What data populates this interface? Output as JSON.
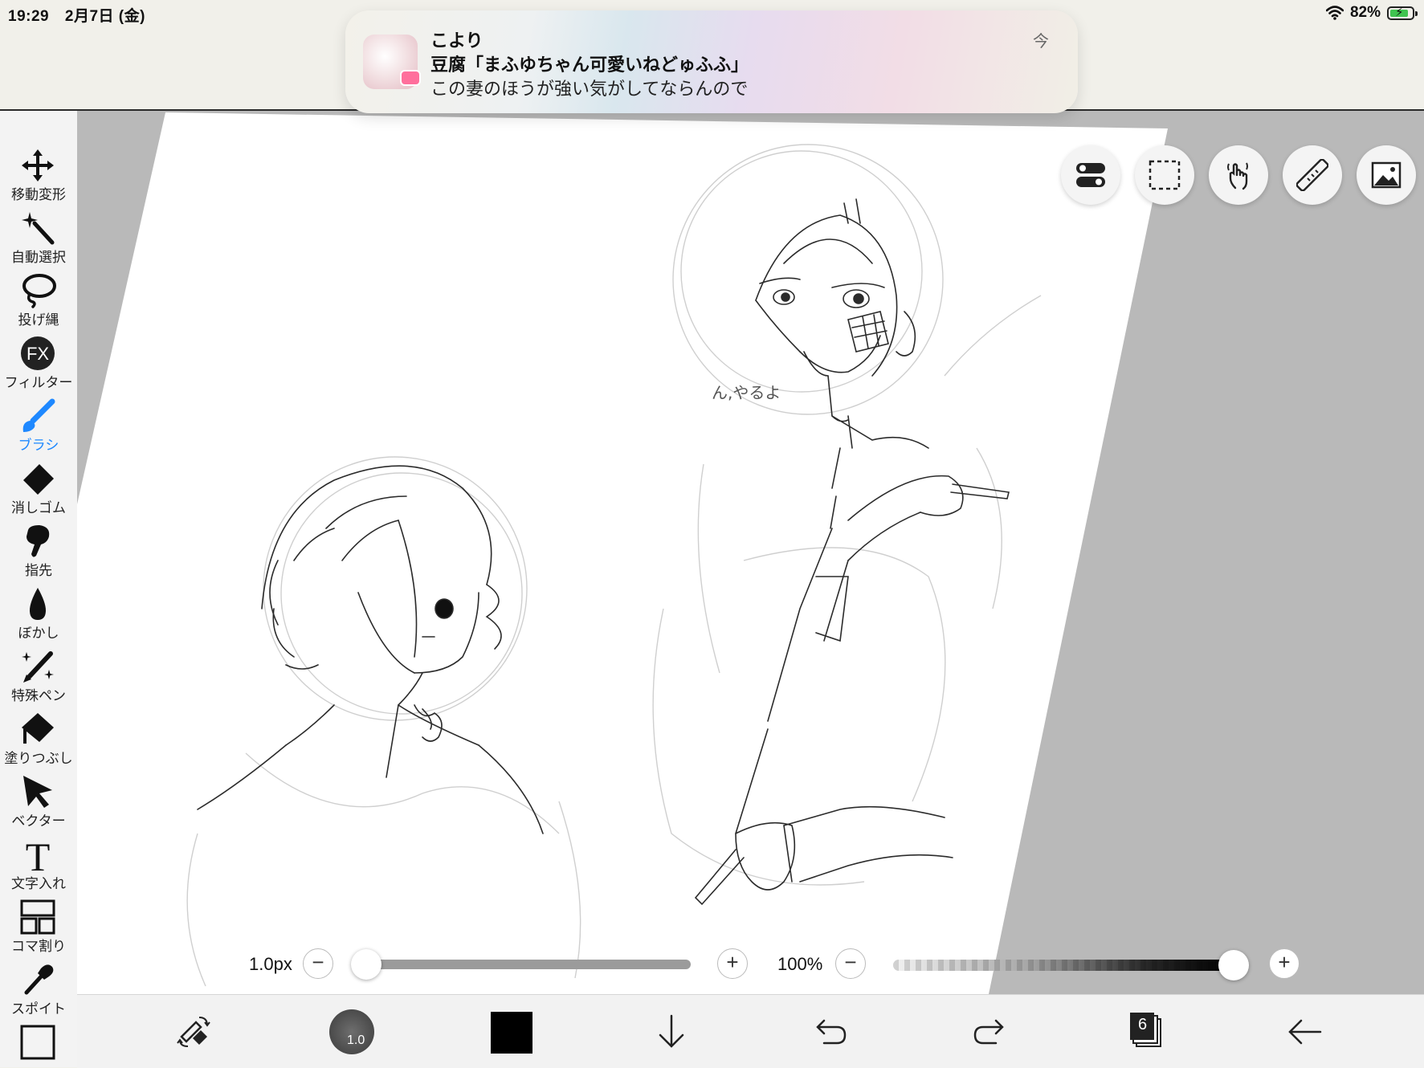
{
  "status": {
    "time": "19:29",
    "date": "2月7日 (金)",
    "battery": "82%"
  },
  "notification": {
    "app_name": "こより",
    "title": "豆腐「まふゆちゃん可愛いねどゅふふ」",
    "body": "この妻のほうが強い気がしてならんので",
    "time": "今"
  },
  "tools": [
    {
      "label": "移動変形",
      "icon": "move-icon"
    },
    {
      "label": "自動選択",
      "icon": "magic-wand-icon"
    },
    {
      "label": "投げ縄",
      "icon": "lasso-icon"
    },
    {
      "label": "フィルター",
      "icon": "fx-icon"
    },
    {
      "label": "ブラシ",
      "icon": "brush-icon",
      "active": true
    },
    {
      "label": "消しゴム",
      "icon": "eraser-icon"
    },
    {
      "label": "指先",
      "icon": "finger-icon"
    },
    {
      "label": "ぼかし",
      "icon": "blur-drop-icon"
    },
    {
      "label": "特殊ペン",
      "icon": "special-pen-icon"
    },
    {
      "label": "塗りつぶし",
      "icon": "fill-bucket-icon"
    },
    {
      "label": "ベクター",
      "icon": "vector-arrow-icon"
    },
    {
      "label": "文字入れ",
      "icon": "text-icon"
    },
    {
      "label": "コマ割り",
      "icon": "panel-icon"
    },
    {
      "label": "スポイト",
      "icon": "eyedropper-icon"
    }
  ],
  "canvas": {
    "handwriting": "ん,やるよ"
  },
  "brush_size": {
    "value": "1.0px",
    "level": 0.0
  },
  "opacity": {
    "value": "100%",
    "level": 1.0
  },
  "bottom": {
    "brush_badge": "1.0",
    "color": "#000000",
    "layer_count": "6"
  },
  "colors": {
    "accent": "#1e88ff",
    "canvas_gray": "#b9b9b9"
  }
}
